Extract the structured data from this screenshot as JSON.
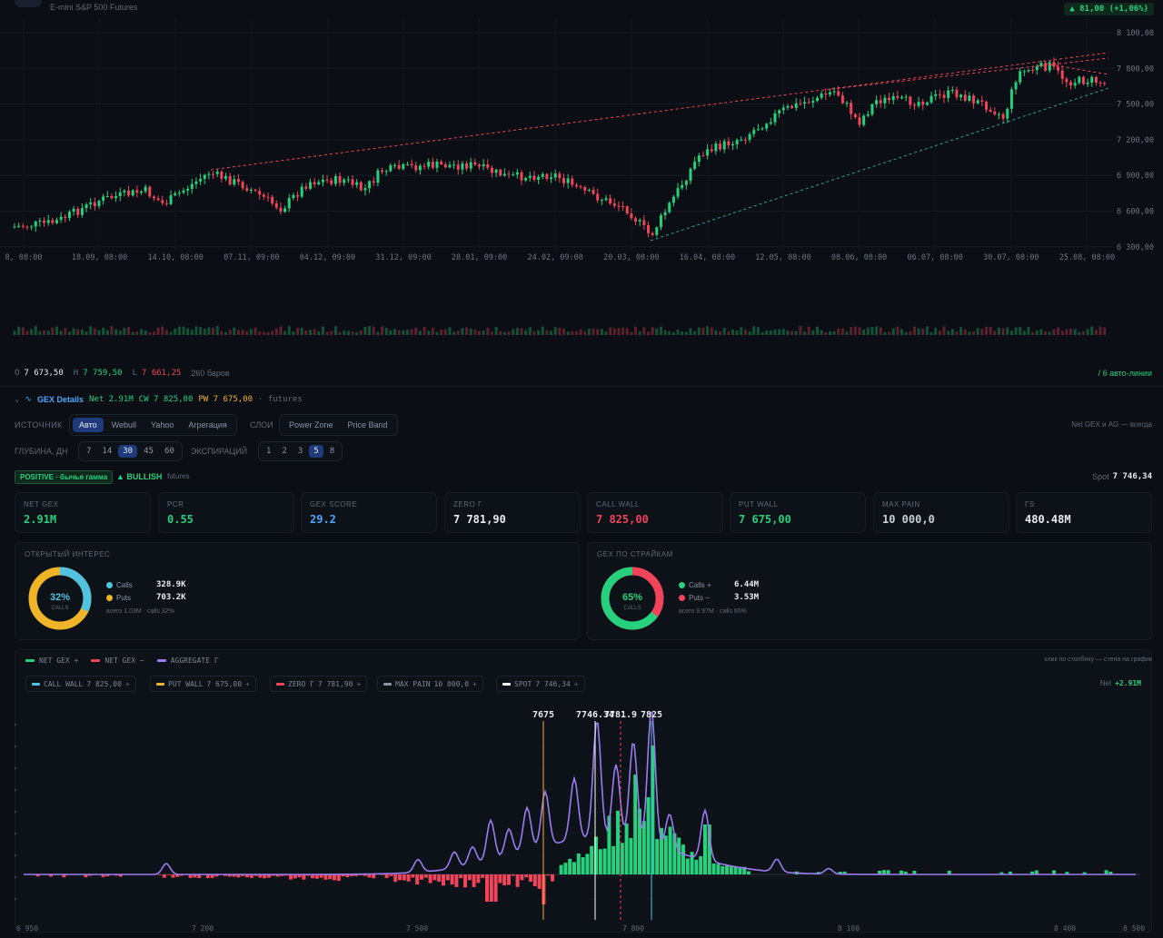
{
  "header": {
    "instrument": "E-mini S&P 500 Futures",
    "change": "▲ 81,00 (+1,06%)"
  },
  "price_chart": {
    "y_ticks": [
      "8 100,00",
      "7 800,00",
      "7 500,00",
      "7 200,00",
      "6 900,00",
      "6 600,00",
      "6 300,00"
    ],
    "x_ticks": [
      "8, 08:00",
      "18.09, 08:00",
      "14.10, 08:00",
      "07.11, 09:00",
      "04.12, 09:00",
      "31.12, 09:00",
      "28.01, 09:00",
      "24.02, 09:00",
      "20.03, 08:00",
      "16.04, 08:00",
      "12.05, 08:00",
      "08.06, 08:00",
      "06.07, 08:00",
      "30.07, 08:00",
      "25.08, 08:00"
    ],
    "colors": {
      "up": "#26d07c",
      "down": "#f0445a",
      "resistance": "#f0445a",
      "support": "#26a69a"
    }
  },
  "ohlc": {
    "o_label": "O",
    "o_value": "7 673,50",
    "h_label": "H",
    "h_value": "7 759,50",
    "l_label": "L",
    "l_value": "7 661,25",
    "bars": "260 баров",
    "auto_lines": "/ 6 авто-линии"
  },
  "gex": {
    "title": "GEX Details",
    "net": "Net 2.91M",
    "cw": "CW 7 825,00",
    "pw": "PW 7 675,00",
    "source_tag": "· futures",
    "source_label": "ИСТОЧНИК",
    "sources": [
      "Авто",
      "Webull",
      "Yahoo",
      "Агрегация"
    ],
    "layers_label": "СЛОИ",
    "layers": [
      "Power Zone",
      "Price Band"
    ],
    "layers_note": "Net GEX и AG — всегда",
    "depth_label": "ГЛУБИНА, ДН",
    "depths": [
      "7",
      "14",
      "30",
      "45",
      "60"
    ],
    "expiry_label": "ЭКСПИРАЦИЙ",
    "expiries": [
      "1",
      "2",
      "3",
      "5",
      "8"
    ],
    "regime": "POSITIVE · бычья гамма",
    "bias": "▲ BULLISH",
    "bias_tag": "futures",
    "spot_label": "Spot",
    "spot_value": "7 746,34"
  },
  "metrics": [
    {
      "title": "NET GEX",
      "value": "2.91M",
      "color": "#26d07c"
    },
    {
      "title": "PCR",
      "value": "0.55",
      "color": "#26d07c"
    },
    {
      "title": "GEX SCORE",
      "value": "29.2",
      "color": "#4aa8ff"
    },
    {
      "title": "ZERO Γ",
      "value": "7 781,90",
      "color": "#e6edf3"
    },
    {
      "title": "CALL WALL",
      "value": "7 825,00",
      "color": "#f0445a"
    },
    {
      "title": "PUT WALL",
      "value": "7 675,00",
      "color": "#26d07c"
    },
    {
      "title": "MAX PAIN",
      "value": "10 000,0",
      "color": "#c9d1d9"
    },
    {
      "title": "ΓS",
      "value": "480.48M",
      "color": "#e6edf3"
    }
  ],
  "open_interest": {
    "title": "ОТКРЫТЫЙ ИНТЕРЕС",
    "pct": "32%",
    "pct_value": 0.32,
    "center_label": "CALLS",
    "calls_label": "Calls",
    "calls_value": "328.9K",
    "puts_label": "Puts",
    "puts_value": "703.2K",
    "footer": "всего 1.03M · calls 32%"
  },
  "gex_strikes": {
    "title": "GEX ПО СТРАЙКАМ",
    "pct": "65%",
    "pct_value": 0.65,
    "center_label": "CALLS",
    "calls_label": "Calls +",
    "calls_value": "6.44M",
    "puts_label": "Puts −",
    "puts_value": "3.53M",
    "footer": "всего 9.97M · calls 65%"
  },
  "profile": {
    "legend": [
      "NET GEX +",
      "NET GEX −",
      "AGGREGATE Γ"
    ],
    "legend_colors": [
      "#26d07c",
      "#f0445a",
      "#9b7cf0"
    ],
    "hint": "клик по столбику — стена на график",
    "tags": [
      {
        "name": "CALL WALL",
        "value": "7 825,00",
        "color": "#4fc3e0"
      },
      {
        "name": "PUT WALL",
        "value": "7 675,00",
        "color": "#f0b429"
      },
      {
        "name": "ZERO Γ",
        "value": "7 781,90",
        "color": "#f0445a"
      },
      {
        "name": "MAX PAIN",
        "value": "10 000,0",
        "color": "#8b95a5"
      },
      {
        "name": "SPOT",
        "value": "7 746,34",
        "color": "#ffffff"
      }
    ],
    "net_label": "Net",
    "net_value": "+2.91M",
    "line_labels": [
      "7675",
      "7746.34",
      "7781.9",
      "7825"
    ],
    "x_ticks": [
      "6 950",
      "7 200",
      "7 500",
      "7 800",
      "8 100",
      "8 400",
      "8 500"
    ]
  }
}
